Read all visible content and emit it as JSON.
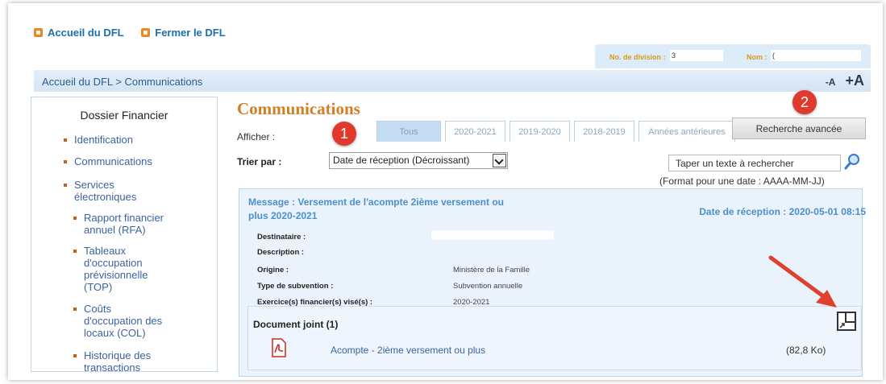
{
  "top_links": {
    "home": "Accueil du DFL",
    "close": "Fermer le DFL"
  },
  "division": {
    "number_label": "No. de division :",
    "number_value": "3",
    "name_label": "Nom :",
    "name_value": "("
  },
  "breadcrumb": {
    "path": "Accueil du DFL > Communications",
    "font_smaller": "-A",
    "font_larger": "+A"
  },
  "sidebar": {
    "title": "Dossier Financier",
    "items": [
      {
        "label": "Identification"
      },
      {
        "label": "Communications"
      },
      {
        "label_line1": "Services",
        "label_line2": "électroniques"
      }
    ],
    "subitems": [
      {
        "lines": [
          "Rapport financier",
          "annuel (RFA)"
        ]
      },
      {
        "lines": [
          "Tableaux",
          "d'occupation",
          "prévisionnelle",
          "(TOP)"
        ]
      },
      {
        "lines": [
          "Coûts",
          "d'occupation des",
          "locaux (COL)"
        ]
      },
      {
        "lines": [
          "Historique des",
          "transactions"
        ]
      }
    ]
  },
  "main": {
    "title": "Communications",
    "afficher_label": "Afficher :",
    "tabs": [
      "Tous",
      "2020-2021",
      "2019-2020",
      "2018-2019",
      "Années antérieures"
    ],
    "advanced_search": "Recherche avancée",
    "sort_label": "Trier par :",
    "sort_value": "Date de réception (Décroissant)",
    "search_placeholder": "Taper un texte à rechercher",
    "date_format_hint": "(Format pour une date : AAAA-MM-JJ)"
  },
  "annotations": {
    "badge1": "1",
    "badge2": "2"
  },
  "message": {
    "title_line1": "Message : Versement de l'acompte 2ième versement ou",
    "title_line2": "plus 2020-2021",
    "reception": "Date de réception : 2020-05-01 08:15",
    "fields": [
      {
        "label": "Destinataire :",
        "value": ""
      },
      {
        "label": "Description :",
        "value": ""
      },
      {
        "label": "Origine :",
        "value": "Ministère de la Famille"
      },
      {
        "label": "Type de subvention :",
        "value": "Subvention annuelle"
      },
      {
        "label": "Exercice(s) financier(s) visé(s) :",
        "value": "2020-2021"
      }
    ],
    "attachment_header": "Document joint (1)",
    "attachment_name": "Acompte - 2ième versement ou plus",
    "attachment_size": "(82,8 Ko)"
  },
  "colors": {
    "accent_orange": "#d27e25",
    "link_blue": "#3a63a0",
    "badge_red": "#e03a2f",
    "arrow_red": "#e0412e"
  }
}
